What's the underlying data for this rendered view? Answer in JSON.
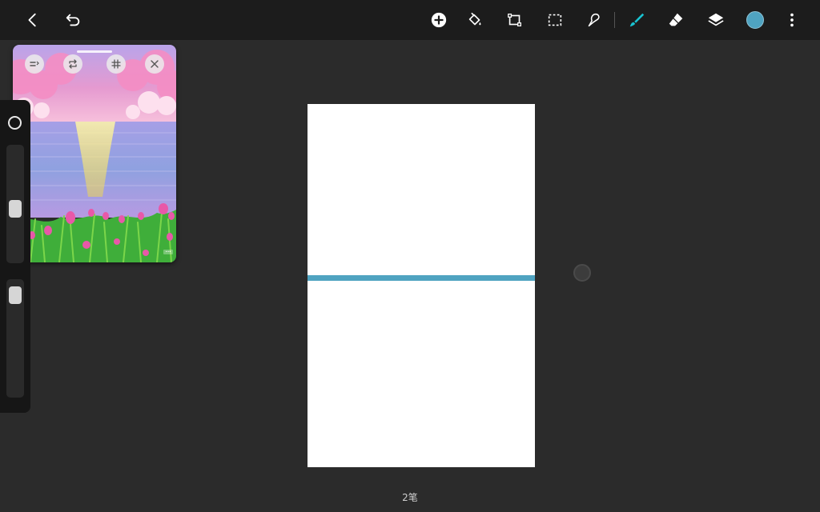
{
  "toolbar": {
    "left": [
      {
        "name": "back-icon"
      },
      {
        "name": "undo-icon"
      }
    ],
    "right": [
      {
        "name": "add-icon"
      },
      {
        "name": "fill-bucket-icon"
      },
      {
        "name": "transform-icon"
      },
      {
        "name": "selection-icon"
      },
      {
        "name": "smudge-icon"
      },
      {
        "name": "brush-icon",
        "active": true
      },
      {
        "name": "eraser-icon"
      },
      {
        "name": "layers-icon"
      },
      {
        "name": "more-icon"
      }
    ],
    "current_color": "#4fa3c1",
    "accent_color": "#19c3d1"
  },
  "reference_window": {
    "buttons": [
      {
        "name": "reference-settings-icon"
      },
      {
        "name": "reference-flip-icon"
      },
      {
        "name": "reference-grid-icon"
      },
      {
        "name": "reference-close-icon"
      }
    ],
    "watermark": "•••",
    "colors": {
      "sky_top": "#c9a8e8",
      "cloud": "#f08fc2",
      "moon": "#f7e64a",
      "sea": "#9b8fe0",
      "grass": "#3fae3a",
      "tulip": "#e858a8"
    }
  },
  "side_panel": {
    "brush_size_level": 0.55,
    "opacity_level": 0.05
  },
  "canvas": {
    "background": "#ffffff",
    "stroke_color": "#4fa3c1"
  },
  "status": {
    "stroke_count": "2笔"
  }
}
